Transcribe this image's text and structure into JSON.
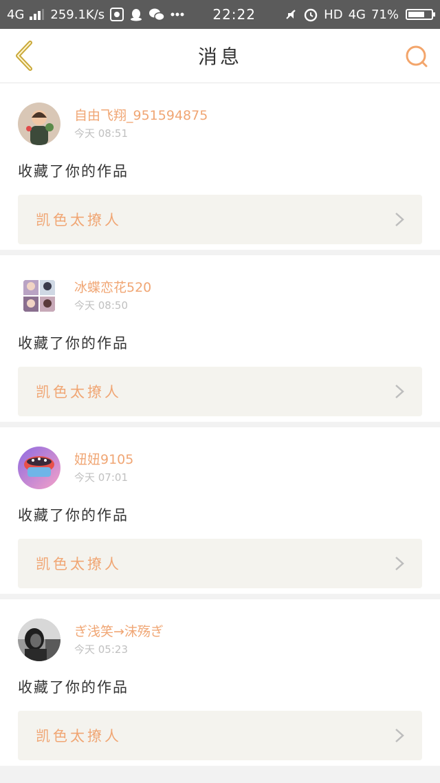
{
  "status_bar": {
    "network": "4G",
    "speed": "259.1K/s",
    "time": "22:22",
    "hd": "HD",
    "data": "4G",
    "battery_text": "71%",
    "battery_level": 0.71
  },
  "header": {
    "title": "消息"
  },
  "messages": [
    {
      "username": "自由飞翔_951594875",
      "time": "今天 08:51",
      "action": "收藏了你的作品",
      "work_title": "凯色太撩人"
    },
    {
      "username": "冰蝶恋花520",
      "time": "今天 08:50",
      "action": "收藏了你的作品",
      "work_title": "凯色太撩人"
    },
    {
      "username": "妞妞9105",
      "time": "今天 07:01",
      "action": "收藏了你的作品",
      "work_title": "凯色太撩人"
    },
    {
      "username": "ぎ浅笑→沫殇ぎ",
      "time": "今天 05:23",
      "action": "收藏了你的作品",
      "work_title": "凯色太撩人"
    }
  ],
  "colors": {
    "accent": "#f0a674",
    "nav_icon": "#c9a83a",
    "search_icon": "#f3a56b"
  },
  "icons": [
    "back-arrow-icon",
    "search-icon",
    "chevron-right-icon",
    "signal-icon",
    "wifi-icon",
    "alarm-icon",
    "battery-icon"
  ]
}
